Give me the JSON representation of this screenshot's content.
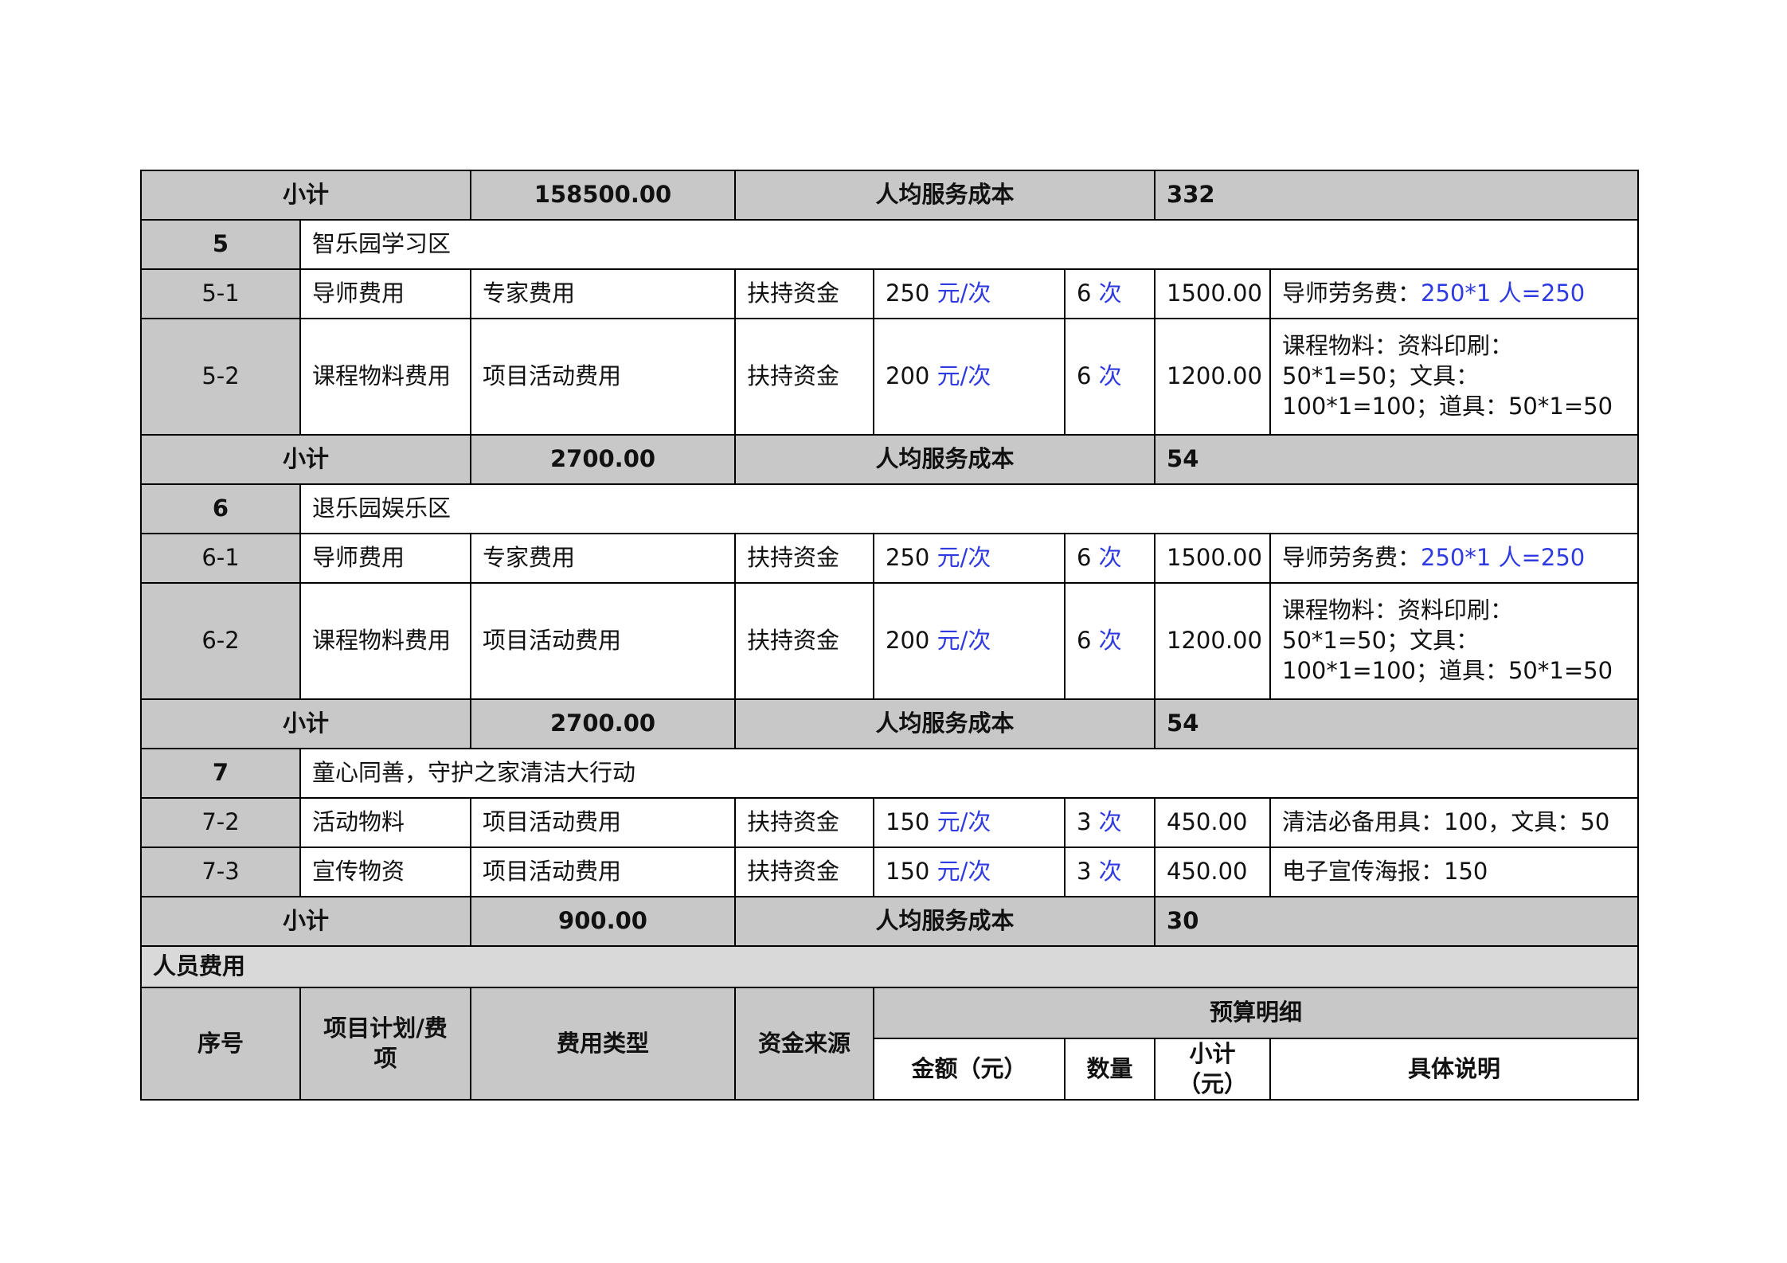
{
  "sections": [
    {
      "subtotal": {
        "label": "小计",
        "amount": "158500.00",
        "cost_label": "人均服务成本",
        "cost": "332"
      }
    },
    {
      "index": "5",
      "title": "智乐园学习区",
      "rows": [
        {
          "id": "5-1",
          "item": "导师费用",
          "type": "专家费用",
          "source": "扶持资金",
          "price": "250",
          "price_unit": " 元/次",
          "qty": "6",
          "qty_unit": " 次",
          "subtotal": "1500.00",
          "desc_plain": "导师劳务费：",
          "desc_blue": "250*1 人=250"
        },
        {
          "id": "5-2",
          "item": "课程物料费用",
          "type": "项目活动费用",
          "source": "扶持资金",
          "price": "200",
          "price_unit": " 元/次",
          "qty": "6",
          "qty_unit": " 次",
          "subtotal": "1200.00",
          "desc_plain": "课程物料：资料印刷：50*1=50；文具：100*1=100；道具：50*1=50",
          "desc_blue": ""
        }
      ],
      "subtotal": {
        "label": "小计",
        "amount": "2700.00",
        "cost_label": "人均服务成本",
        "cost": "54"
      }
    },
    {
      "index": "6",
      "title": "退乐园娱乐区",
      "rows": [
        {
          "id": "6-1",
          "item": "导师费用",
          "type": "专家费用",
          "source": "扶持资金",
          "price": "250",
          "price_unit": " 元/次",
          "qty": "6",
          "qty_unit": " 次",
          "subtotal": "1500.00",
          "desc_plain": "导师劳务费：",
          "desc_blue": "250*1 人=250"
        },
        {
          "id": "6-2",
          "item": "课程物料费用",
          "type": "项目活动费用",
          "source": "扶持资金",
          "price": "200",
          "price_unit": " 元/次",
          "qty": "6",
          "qty_unit": " 次",
          "subtotal": "1200.00",
          "desc_plain": "课程物料：资料印刷：50*1=50；文具：100*1=100；道具：50*1=50",
          "desc_blue": ""
        }
      ],
      "subtotal": {
        "label": "小计",
        "amount": "2700.00",
        "cost_label": "人均服务成本",
        "cost": "54"
      }
    },
    {
      "index": "7",
      "title": "童心同善，守护之家清洁大行动",
      "rows": [
        {
          "id": "7-2",
          "item": "活动物料",
          "type": "项目活动费用",
          "source": "扶持资金",
          "price": "150",
          "price_unit": " 元/次",
          "qty": "3",
          "qty_unit": " 次",
          "subtotal": "450.00",
          "desc_plain": "清洁必备用具：100，文具：50",
          "desc_blue": ""
        },
        {
          "id": "7-3",
          "item": "宣传物资",
          "type": "项目活动费用",
          "source": "扶持资金",
          "price": "150",
          "price_unit": " 元/次",
          "qty": "3",
          "qty_unit": " 次",
          "subtotal": "450.00",
          "desc_plain": "电子宣传海报：150",
          "desc_blue": ""
        }
      ],
      "subtotal": {
        "label": "小计",
        "amount": "900.00",
        "cost_label": "人均服务成本",
        "cost": "30"
      }
    }
  ],
  "personnel": {
    "title": "人员费用",
    "headers": {
      "index": "序号",
      "item": "项目计划/费项",
      "type": "费用类型",
      "source": "资金来源",
      "detail": "预算明细",
      "amount": "金额（元）",
      "qty": "数量",
      "subtotal": "小计（元）",
      "desc": "具体说明"
    }
  }
}
